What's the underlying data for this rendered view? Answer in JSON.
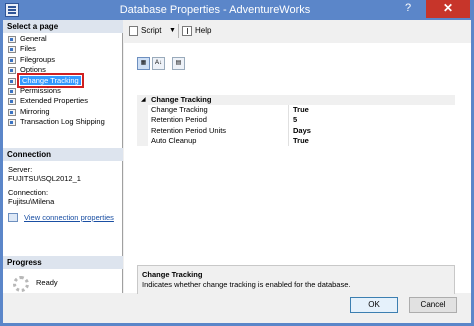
{
  "window": {
    "title": "Database Properties - AdventureWorks",
    "help_glyph": "?",
    "close_glyph": "✕"
  },
  "left_pane": {
    "select_page_header": "Select a page",
    "pages": [
      {
        "label": "General",
        "selected": false
      },
      {
        "label": "Files",
        "selected": false
      },
      {
        "label": "Filegroups",
        "selected": false
      },
      {
        "label": "Options",
        "selected": false
      },
      {
        "label": "Change Tracking",
        "selected": true
      },
      {
        "label": "Permissions",
        "selected": false
      },
      {
        "label": "Extended Properties",
        "selected": false
      },
      {
        "label": "Mirroring",
        "selected": false
      },
      {
        "label": "Transaction Log Shipping",
        "selected": false
      }
    ],
    "connection_header": "Connection",
    "server_label": "Server:",
    "server_value": "FUJITSU\\SQL2012_1",
    "connection_label": "Connection:",
    "connection_value": "Fujitsu\\Milena",
    "view_connection_link": "View connection properties",
    "progress_header": "Progress",
    "progress_status": "Ready"
  },
  "toolbar": {
    "script_label": "Script",
    "script_dropdown_glyph": "▼",
    "help_label": "Help"
  },
  "property_grid": {
    "sort_az_glyph": "A↓",
    "category": "Change Tracking",
    "category_toggle": "◢",
    "properties": [
      {
        "name": "Change Tracking",
        "value": "True"
      },
      {
        "name": "Retention Period",
        "value": "5"
      },
      {
        "name": "Retention Period Units",
        "value": "Days"
      },
      {
        "name": "Auto Cleanup",
        "value": "True"
      }
    ]
  },
  "description": {
    "title": "Change Tracking",
    "text": "Indicates whether change tracking is enabled for the database."
  },
  "footer": {
    "ok_label": "OK",
    "cancel_label": "Cancel"
  },
  "colors": {
    "title_bar": "#5b86c9",
    "close_button": "#c7352a",
    "selection": "#3399ff",
    "highlight_box": "#d02020"
  }
}
